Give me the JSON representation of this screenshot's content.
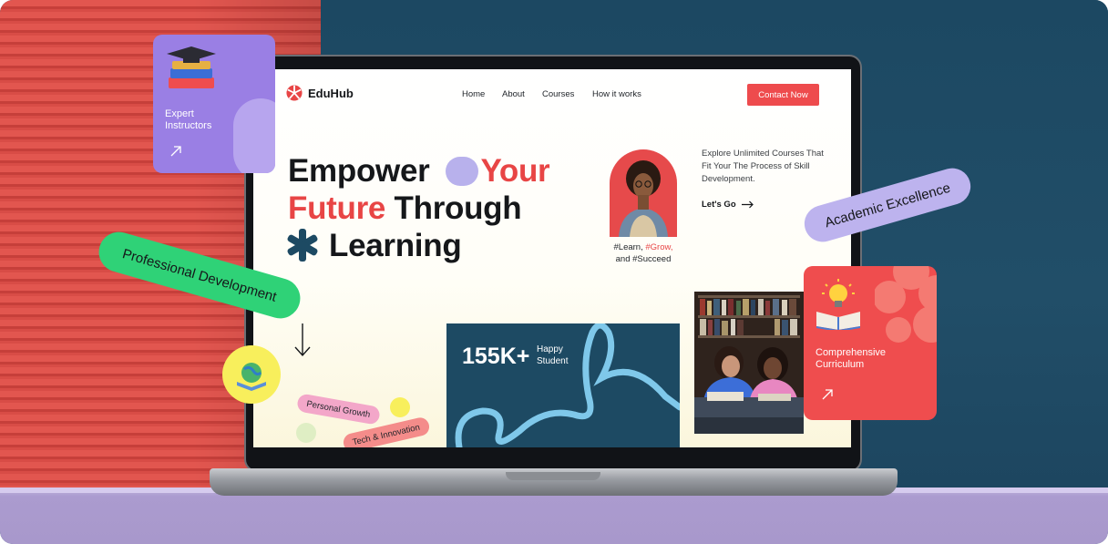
{
  "site": {
    "logo_text": "EduHub",
    "nav": [
      "Home",
      "About",
      "Courses",
      "How it works"
    ],
    "cta_label": "Contact Now",
    "hero": {
      "line1_a": "Empower",
      "line1_b": "Your",
      "line2_a": "Future",
      "line2_b": "Through",
      "line3": "Learning"
    },
    "tagline_a": "#Learn,",
    "tagline_b": "#Grow,",
    "tagline_c": "and #Succeed",
    "explore_text": "Explore Unlimited Courses That Fit Your The Process of Skill Development.",
    "lets_go": "Let's Go",
    "stats": {
      "value": "155K+",
      "label_1": "Happy",
      "label_2": "Student"
    },
    "chips": {
      "personal_growth": "Personal Growth",
      "tech_innovation": "Tech & Innovation"
    }
  },
  "overlays": {
    "expert_card": {
      "line1": "Expert",
      "line2": "Instructors"
    },
    "curriculum_card": {
      "line1": "Comprehensive",
      "line2": "Curriculum"
    },
    "pill_professional": "Professional Development",
    "pill_academic": "Academic Excellence"
  },
  "colors": {
    "accent_red": "#ee4b4d",
    "navy": "#1d4a63",
    "purple": "#9a7fe4",
    "green": "#2fd277",
    "lavender": "#b8b1ec"
  },
  "icons": [
    "eduhub-logo-icon",
    "asterisk-icon",
    "arrow-right-icon",
    "arrow-down-icon",
    "arrow-up-right-icon",
    "books-icon",
    "globe-book-icon",
    "lightbulb-book-icon"
  ]
}
